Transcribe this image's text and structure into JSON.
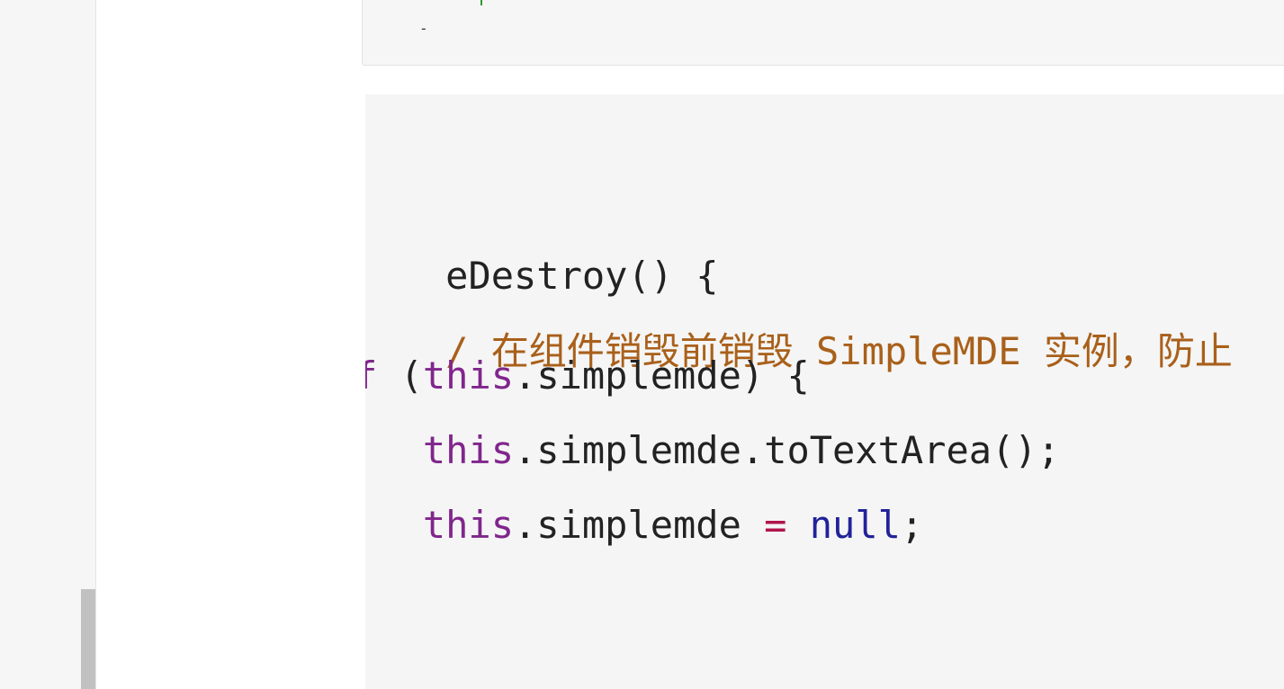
{
  "upper_block": {
    "dash": "-"
  },
  "code": {
    "line1": {
      "text": "eDestroy() {"
    },
    "line2": {
      "comment": "/ 在组件销毁前销毁 SimpleMDE 实例，防止"
    },
    "line3": {
      "kw": "f",
      "paren": " (",
      "this": "this",
      "rest": ".simplemde) {"
    },
    "line4": {
      "indent": "   ",
      "this": "this",
      "rest": ".simplemde.toTextArea();"
    },
    "line5": {
      "indent": "   ",
      "this": "this",
      "mid": ".simplemde ",
      "op": "=",
      "space": " ",
      "null": "null",
      "end": ";"
    }
  },
  "colors": {
    "comment": "#a9601a",
    "keyword": "#80268c",
    "null": "#22229a",
    "operator": "#b0144a",
    "code_bg": "#f5f5f5",
    "sidebar_bg": "#f6f6f6"
  }
}
